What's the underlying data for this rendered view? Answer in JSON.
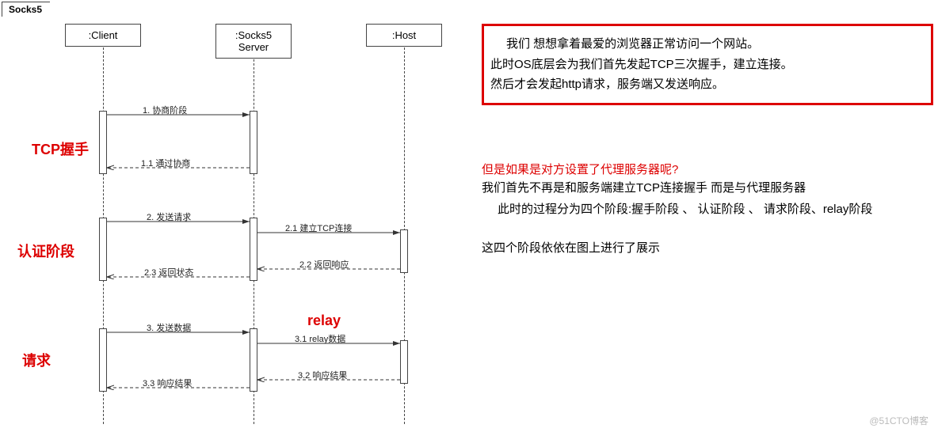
{
  "title": "Socks5",
  "actors": {
    "client": ":Client",
    "server": ":Socks5 Server",
    "host": ":Host"
  },
  "phases": {
    "tcp": "TCP握手",
    "auth": "认证阶段",
    "req": "请求",
    "relay": "relay"
  },
  "messages": {
    "m1": "1. 协商阶段",
    "m11": "1.1 通过协商",
    "m2": "2. 发送请求",
    "m21": "2.1 建立TCP连接",
    "m22": "2.2 返回响应",
    "m23": "2.3 返回状态",
    "m3": "3. 发送数据",
    "m31": "3.1 relay数据",
    "m32": "3.2 响应结果",
    "m33": "3.3 响应结果"
  },
  "text": {
    "box1": "我们 想想拿着最爱的浏览器正常访问一个网站。",
    "box2": "此时OS底层会为我们首先发起TCP三次握手，建立连接。",
    "box3": "然后才会发起http请求，服务端又发送响应。",
    "q": "但是如果是对方设置了代理服务器呢?",
    "p1": "我们首先不再是和服务端建立TCP连接握手 而是与代理服务器",
    "p2": "此时的过程分为四个阶段:握手阶段 、 认证阶段 、 请求阶段、relay阶段",
    "p3": "这四个阶段依依在图上进行了展示"
  },
  "watermark": "@51CTO博客"
}
